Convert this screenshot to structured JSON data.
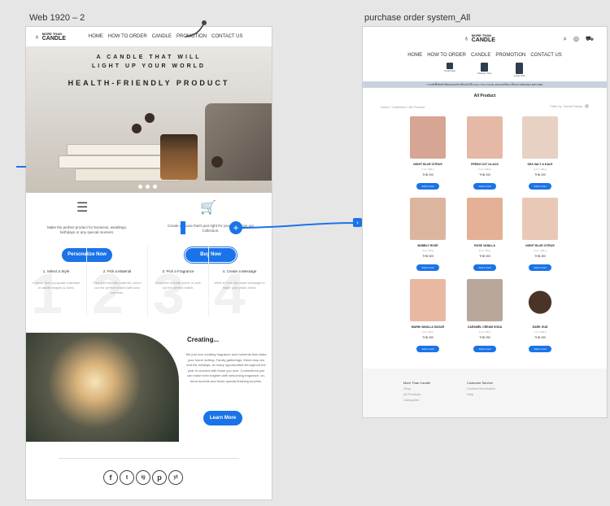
{
  "frames": {
    "left_title": "Web 1920 – 2",
    "right_title": "purchase order system_All"
  },
  "brand": {
    "line1": "MORE THAN",
    "line2": "CANDLE"
  },
  "nav": [
    "HOME",
    "HOW TO ORDER",
    "CANDLE",
    "PROMOTION",
    "CONTACT US"
  ],
  "hero": {
    "tagline_1": "A CANDLE THAT WILL",
    "tagline_2": "LIGHT UP YOUR WORLD",
    "headline": "HEALTH-FRIENDLY PRODUCT"
  },
  "features": [
    {
      "icon": "sliders-icon",
      "text": "Make the perfect product for business, weddings, birthdays or any special moment.",
      "button": "Personalize Now"
    },
    {
      "icon": "cart-icon",
      "text": "Create a house that's just right for your style from our Collection.",
      "button": "Buy Now"
    }
  ],
  "steps": [
    {
      "num": "1",
      "title": "1. Select a Style",
      "text": "Choose from a popular collection of candle shapes & sizes."
    },
    {
      "num": "2",
      "title": "2. Pick a Material",
      "text": "Find their favorite material, colors our the perfect match (with wax one wax."
    },
    {
      "num": "3",
      "title": "3. Pick a Fragrance",
      "text": "Find their favorite scent, or pick out the perfect match."
    },
    {
      "num": "4",
      "title": "4. Create a Message",
      "text": "Write a From-the-heart message to make your photo shine."
    }
  ],
  "creating": {
    "title": "Creating...",
    "body": "We just love creating fragrance and moments that make your home inviting. Family gatherings, friend drop-ins and the holidays, so many opportunities throughout the year to connect with those you love. Connections you can make even brighter with welcoming fragrance, on-trend accents and those special finishing touches.",
    "button": "Learn More"
  },
  "social": [
    "f",
    "t",
    "ig",
    "p",
    "yt"
  ],
  "shop": {
    "sizes": [
      "Small Size",
      "Medium Size",
      "Large Size"
    ],
    "banner": "ระบบสั่งซื้อสินค้าเทียนหอมธุรกิจเทียนเจ้าเป็น More Than Candle ออกแบบได้เอง เป็นแบรนด์ของคุณ MRCOME",
    "title": "All Product",
    "breadcrumb": "Home / Collection / All Product",
    "filter": "Filter by: Scent Family",
    "products": [
      {
        "name": "NIGHT BLUE CITRUS",
        "size": "7 oz / 200 g",
        "price": "THB 290",
        "btn": "Add to Cart",
        "color": "#d6a594"
      },
      {
        "name": "FRESH CUT LILACS",
        "size": "7 oz / 200 g",
        "price": "THB 290",
        "btn": "Add to Cart",
        "color": "#e5b9a5"
      },
      {
        "name": "SEA SALT & KALE",
        "size": "4 oz / 100 g",
        "price": "THB 290",
        "btn": "Add to Cart",
        "color": "#e7d1c2"
      },
      {
        "name": "BUBBLY ROSÉ",
        "size": "4 oz / 80 g",
        "price": "THB 300",
        "btn": "Add to Cart",
        "color": "#dcb59f"
      },
      {
        "name": "ROSE VANILLA",
        "size": "8 oz / 80 g",
        "price": "THB 300",
        "btn": "Add to Cart",
        "color": "#e4b196"
      },
      {
        "name": "NIGHT BLUE CITRUS",
        "size": "4 oz / 100 g",
        "price": "THB 280",
        "btn": "Add to Cart",
        "color": "#eac8b7"
      },
      {
        "name": "WARM VANILLA SUGAR",
        "size": "3 oz / 80 g",
        "price": "THB 250",
        "btn": "Add to Cart",
        "color": "#e9b8a2"
      },
      {
        "name": "CARAMEL CREAM SODA",
        "size": "6 oz / 80 g",
        "price": "THB 250",
        "btn": "Add to Cart",
        "color": "#b9a79b"
      },
      {
        "name": "DARK OUD",
        "size": "7 oz / 200 g",
        "price": "THB 250",
        "btn": "Add to Cart",
        "color": "#ffffff"
      }
    ],
    "footer": {
      "col1_title": "More Than Candle",
      "col1": [
        "Shop",
        "All Products",
        "Categories"
      ],
      "col2_title": "Customer Service",
      "col2": [
        "Contact Information",
        "Help"
      ]
    }
  },
  "colors": {
    "accent": "#1a73e8",
    "canvas": "#e6e6e6"
  }
}
